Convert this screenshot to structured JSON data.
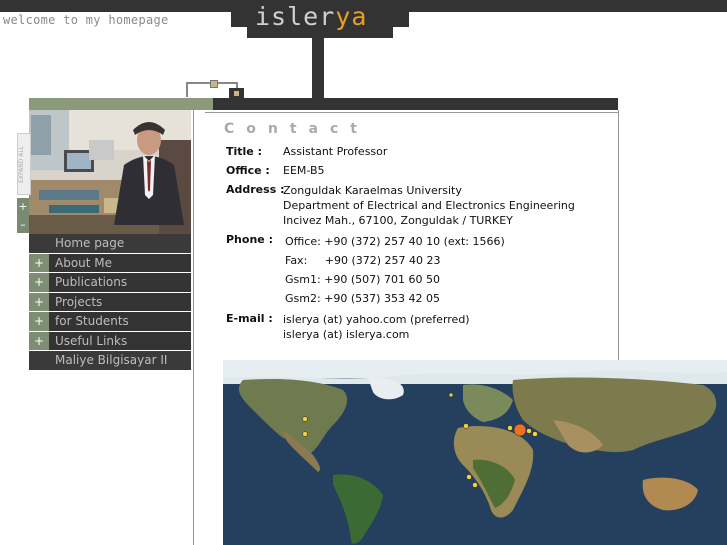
{
  "header": {
    "welcome_text": "welcome to my homepage",
    "logo_main": "isler",
    "logo_accent": "ya"
  },
  "side_tab_text": "EXPAND ALL",
  "side_controls": {
    "plus": "+",
    "minus": "–"
  },
  "menu": {
    "items": [
      {
        "label": "Home page",
        "has_plus": false
      },
      {
        "label": "About Me",
        "has_plus": true
      },
      {
        "label": "Publications",
        "has_plus": true
      },
      {
        "label": "Projects",
        "has_plus": true
      },
      {
        "label": "for Students",
        "has_plus": true
      },
      {
        "label": "Useful Links",
        "has_plus": true
      },
      {
        "label": "Maliye Bilgisayar II",
        "has_plus": false
      }
    ],
    "plus_symbol": "+"
  },
  "contact": {
    "heading": "Contact",
    "title_label": "Title :",
    "title_value": "Assistant Professor",
    "office_label": "Office :",
    "office_value": "EEM-B5",
    "address_label": "Address :",
    "address_lines": [
      "Zonguldak Karaelmas University",
      "Department of Electrical and Electronics Engineering",
      "Incivez Mah., 67100, Zonguldak / TURKEY"
    ],
    "phone_label": "Phone :",
    "phone_lines": [
      "Office: +90 (372) 257 40 10 (ext: 1566)",
      "Fax:     +90 (372) 257 40 23",
      "Gsm1: +90 (507) 701 60 50",
      "Gsm2: +90 (537) 353 42 05"
    ],
    "email_label": "E-mail :",
    "email_lines": [
      "islerya (at) yahoo.com (preferred)",
      "islerya (at) islerya.com"
    ]
  },
  "colors": {
    "dark_bar": "#333333",
    "menu_plus": "#7e8e74",
    "logo_accent": "#e8a020",
    "map_marker": "#f07020"
  }
}
